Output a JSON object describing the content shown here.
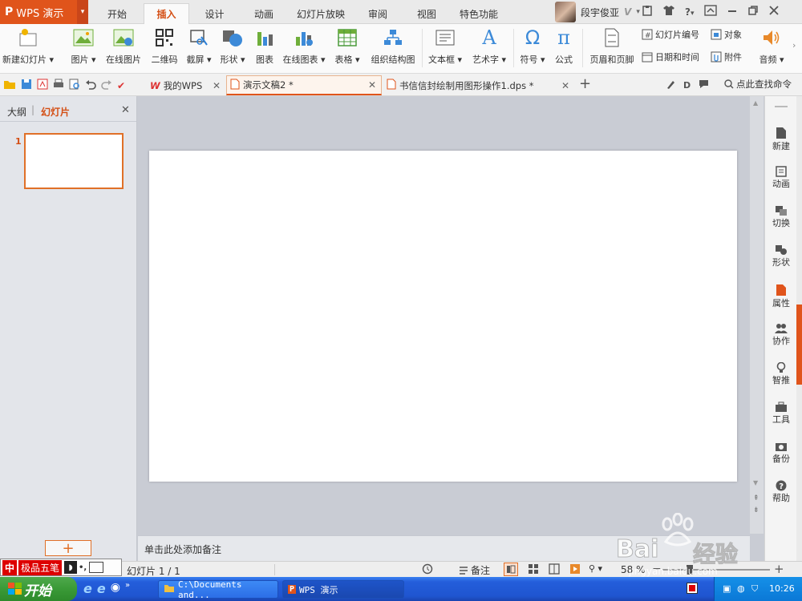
{
  "app": {
    "menu_logo": "P",
    "menu_name": "WPS 演示",
    "brand_color": "#e0541b"
  },
  "ribbon_tabs": [
    "开始",
    "插入",
    "设计",
    "动画",
    "幻灯片放映",
    "审阅",
    "视图",
    "特色功能"
  ],
  "user": {
    "name": "段宇俊亚"
  },
  "window_controls": {
    "help": "?"
  },
  "ribbon": {
    "new_slide": "新建幻灯片",
    "picture": "图片",
    "online_picture": "在线图片",
    "qrcode": "二维码",
    "screenshot": "截屏",
    "shape": "形状",
    "chart": "图表",
    "online_chart": "在线图表",
    "table": "表格",
    "org_chart": "组织结构图",
    "textbox": "文本框",
    "wordart": "艺术字",
    "symbol": "符号",
    "formula": "公式",
    "header_footer": "页眉和页脚",
    "slide_number": "幻灯片编号",
    "date_time": "日期和时间",
    "object": "对象",
    "attachment": "附件",
    "audio": "音频"
  },
  "doc_tabs": [
    {
      "label": "我的WPS"
    },
    {
      "label": "演示文稿2 *"
    },
    {
      "label": "书信信封绘制用图形操作1.dps *"
    }
  ],
  "find_command": "点此查找命令",
  "left_pane": {
    "outline": "大纲",
    "slides": "幻灯片",
    "thumb_number": "1"
  },
  "notes_placeholder": "单击此处添加备注",
  "right_tools": [
    "新建",
    "动画",
    "切换",
    "形状",
    "属性",
    "协作",
    "智推",
    "工具",
    "备份",
    "帮助"
  ],
  "status": {
    "slide_info": "幻灯片 1 / 1",
    "notes": "备注",
    "zoom": "58 %"
  },
  "ime": {
    "logo": "中",
    "name": "极品五笔"
  },
  "taskbar": {
    "start": "开始",
    "item1": "C:\\Documents and...",
    "item2": "WPS 演示",
    "clock": "10:26"
  },
  "watermark": {
    "brand": "Bai",
    "brand2": "经验",
    "url": "jingyan.baidu.com"
  }
}
